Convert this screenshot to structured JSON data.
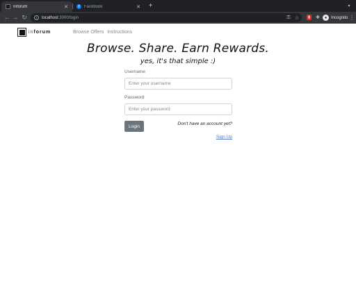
{
  "browser": {
    "tabs": [
      {
        "title": "Inforum",
        "active": true
      },
      {
        "title": "Facebook",
        "active": false
      }
    ],
    "new_tab": "+",
    "address": {
      "host": "localhost",
      "path": ":3000/login"
    },
    "profile_label": "Incognito"
  },
  "page": {
    "logo": {
      "prefix": "in",
      "name": "forum"
    },
    "nav": [
      "Browse Offers",
      "Instructions"
    ],
    "headline": "Browse. Share. Earn Rewards.",
    "subheadline": "yes, it's that simple :)",
    "form": {
      "username_label": "Username",
      "username_placeholder": "Enter your username",
      "password_label": "Password",
      "password_placeholder": "Enter your password",
      "login_button": "Login",
      "signup_prompt": "Don't have an account yet?",
      "signup_link": "Sign Up"
    }
  },
  "colors": {
    "chrome_dark": "#202124",
    "chrome_toolbar": "#35363a",
    "button_gray": "#6c757d",
    "link_blue": "#4a7bd0"
  }
}
